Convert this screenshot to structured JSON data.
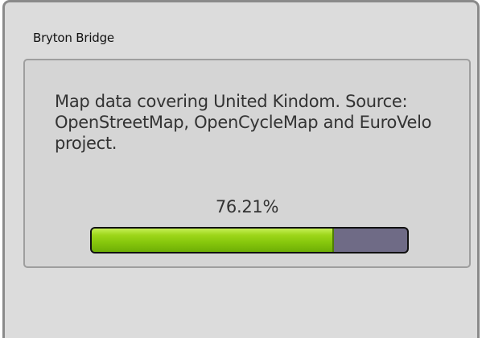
{
  "window": {
    "title": "Bryton Bridge"
  },
  "panel": {
    "description": "Map data covering United Kindom. Source: OpenStreetMap, OpenCycleMap and EuroVelo project.",
    "progress_label": "76.21%",
    "progress_value": 0.7621,
    "colors": {
      "fill": "#8fcc12",
      "track": "#6f6b86"
    }
  }
}
